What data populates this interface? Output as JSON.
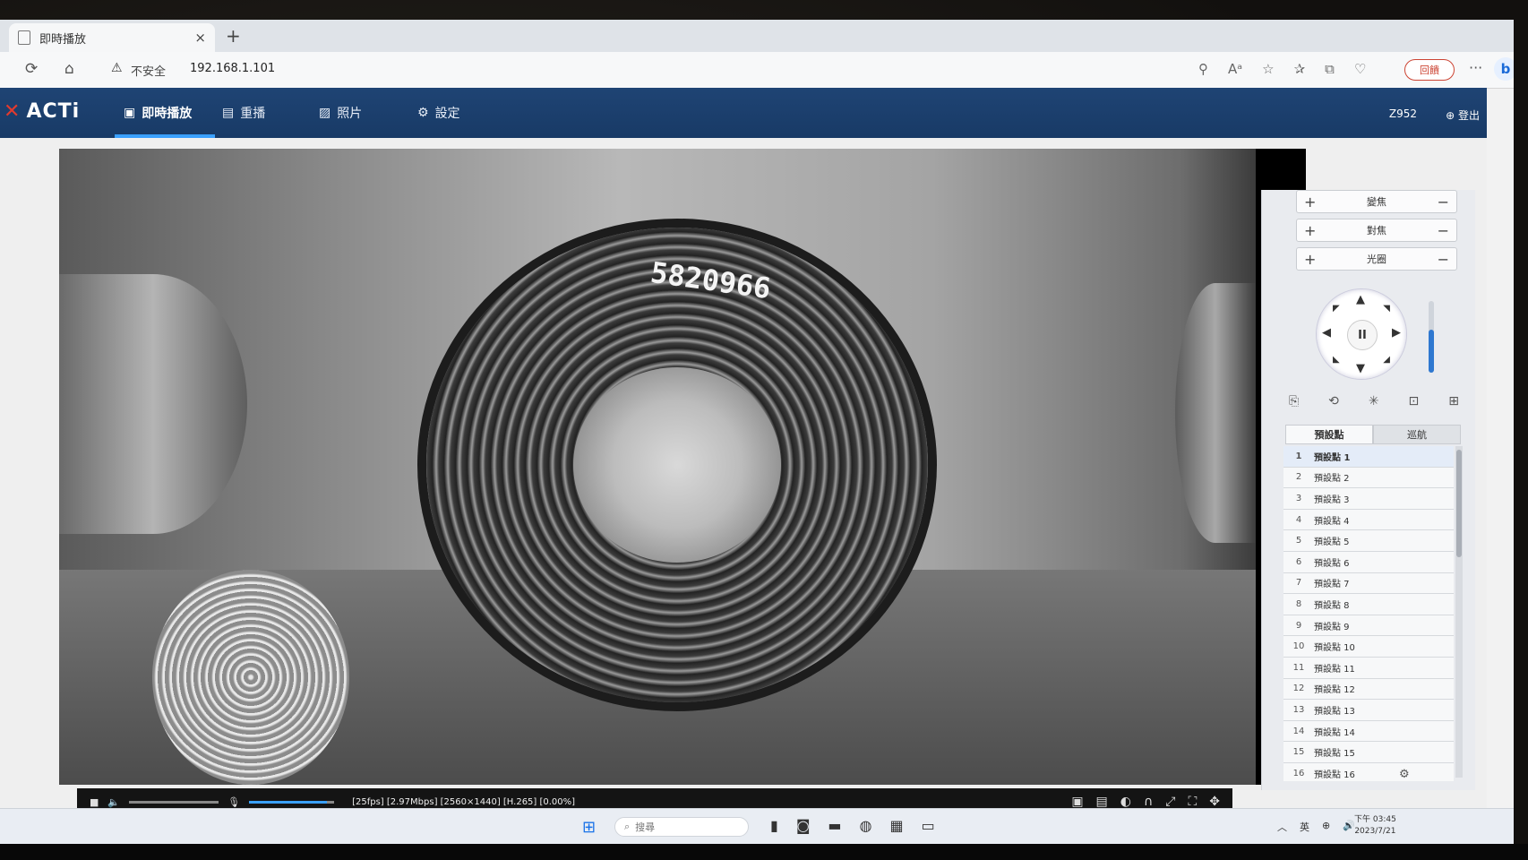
{
  "browser": {
    "tab_title": "即時播放",
    "tab_close": "×",
    "new_tab": "+",
    "security_warning": "不安全",
    "url": "192.168.1.101",
    "feedback_label": "回饋",
    "more_label": "···",
    "bing_label": "b"
  },
  "app": {
    "logo": "ACTi",
    "nav": [
      {
        "label": "即時播放",
        "icon": "monitor-icon"
      },
      {
        "label": "重播",
        "icon": "film-icon"
      },
      {
        "label": "照片",
        "icon": "image-icon"
      },
      {
        "label": "設定",
        "icon": "gear-icon"
      }
    ],
    "user": "Z952",
    "logout_label": "登出"
  },
  "video": {
    "coil_number": "5820966",
    "stream_info": "[25fps] [2.97Mbps] [2560×1440] [H.265] [0.00%]"
  },
  "ptz": {
    "zoom_label": "變焦",
    "focus_label": "對焦",
    "iris_label": "光圈",
    "plus": "+",
    "minus": "−",
    "pause_label": "II",
    "zoom_level": 0.6,
    "tabs": [
      "預設點",
      "巡航"
    ],
    "active_tab": "預設點",
    "presets": [
      {
        "num": "1",
        "name": "預設點 1"
      },
      {
        "num": "2",
        "name": "預設點 2"
      },
      {
        "num": "3",
        "name": "預設點 3"
      },
      {
        "num": "4",
        "name": "預設點 4"
      },
      {
        "num": "5",
        "name": "預設點 5"
      },
      {
        "num": "6",
        "name": "預設點 6"
      },
      {
        "num": "7",
        "name": "預設點 7"
      },
      {
        "num": "8",
        "name": "預設點 8"
      },
      {
        "num": "9",
        "name": "預設點 9"
      },
      {
        "num": "10",
        "name": "預設點 10"
      },
      {
        "num": "11",
        "name": "預設點 11"
      },
      {
        "num": "12",
        "name": "預設點 12"
      },
      {
        "num": "13",
        "name": "預設點 13"
      },
      {
        "num": "14",
        "name": "預設點 14"
      },
      {
        "num": "15",
        "name": "預設點 15"
      },
      {
        "num": "16",
        "name": "預設點 16"
      }
    ]
  },
  "taskbar": {
    "search_placeholder": "搜尋",
    "lang": "英",
    "time": "下午 03:45",
    "date": "2023/7/21"
  },
  "colors": {
    "appbar": "#1f4474",
    "accent": "#3aa0ff"
  }
}
